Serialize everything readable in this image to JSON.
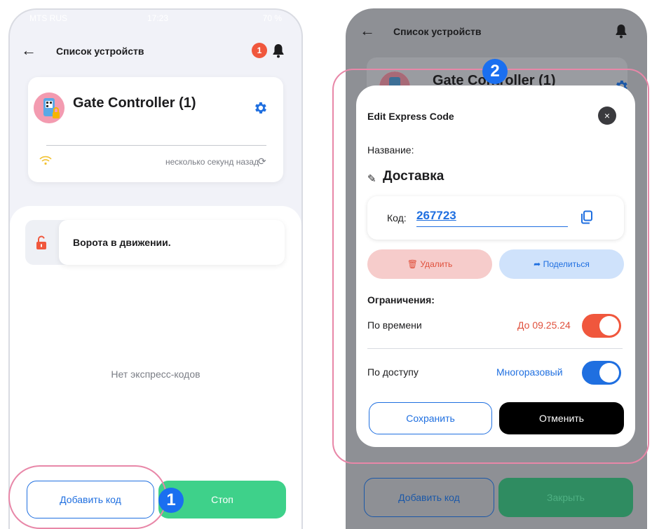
{
  "phone1": {
    "status_bar": {
      "carrier": "MTS RUS",
      "time": "17:23",
      "battery": "70 %"
    },
    "header": {
      "title": "Список устройств",
      "notification_count": "1"
    },
    "device": {
      "name": "Gate Controller (1)",
      "last_seen": "несколько секунд назад"
    },
    "gate_status": "Ворота в движении.",
    "empty_message": "Нет экспресс-кодов",
    "buttons": {
      "add_code": "Добавить код",
      "stop": "Стоп"
    }
  },
  "phone2": {
    "header": {
      "title": "Список устройств"
    },
    "device": {
      "name": "Gate Controller (1)"
    },
    "buttons": {
      "add_code": "Добавить код",
      "close": "Закрыть"
    }
  },
  "modal": {
    "title": "Edit Express Code",
    "close_glyph": "×",
    "name_label": "Название:",
    "name_value": "Доставка",
    "code_label": "Код:",
    "code_value": "267723",
    "delete_label": "Удалить",
    "share_label": "Поделиться",
    "restrictions_title": "Ограничения:",
    "time": {
      "label": "По времени",
      "value": "До 09.25.24",
      "enabled": true
    },
    "access": {
      "label": "По доступу",
      "value": "Многоразовый",
      "enabled": true
    },
    "save_label": "Сохранить",
    "cancel_label": "Отменить"
  },
  "callouts": {
    "first": "1",
    "second": "2"
  },
  "colors": {
    "accent_blue": "#1f6fe0",
    "danger_red": "#f0573d",
    "stop_green": "#3ed18a",
    "highlight_pink": "#e887a8"
  }
}
